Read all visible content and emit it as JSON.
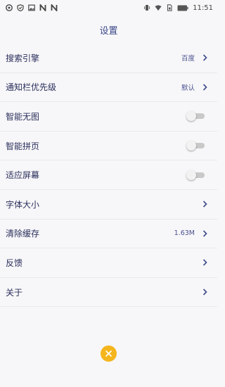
{
  "status_bar": {
    "time": "11:51",
    "left_icons": [
      "aperture-icon",
      "shield-icon",
      "image-icon",
      "n-icon",
      "n-icon"
    ],
    "right_icons": [
      "vibrate-icon",
      "wifi-icon",
      "sim-icon",
      "battery-icon"
    ]
  },
  "header": {
    "title": "设置"
  },
  "settings": {
    "search_engine": {
      "label": "搜索引擎",
      "value": "百度"
    },
    "notification_priority": {
      "label": "通知栏优先级",
      "value": "默认"
    },
    "smart_no_image": {
      "label": "智能无图",
      "on": false
    },
    "smart_page_join": {
      "label": "智能拼页",
      "on": false
    },
    "fit_screen": {
      "label": "适应屏幕",
      "on": false
    },
    "font_size": {
      "label": "字体大小"
    },
    "clear_cache": {
      "label": "清除缓存",
      "value": "1.63M"
    },
    "feedback": {
      "label": "反馈"
    },
    "about": {
      "label": "关于"
    }
  },
  "colors": {
    "accent": "#3e4a8a",
    "close_button": "#f5b51d",
    "background": "#f7f7f9"
  }
}
